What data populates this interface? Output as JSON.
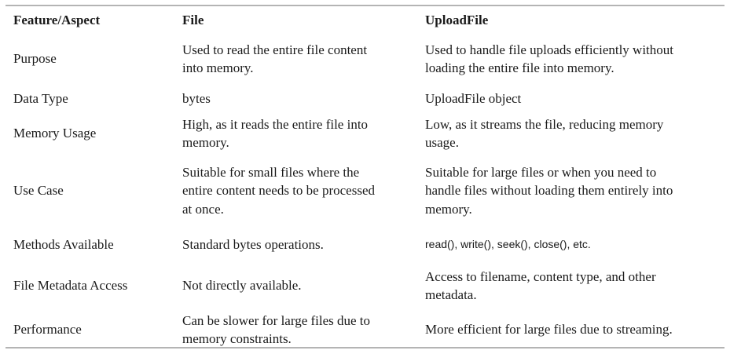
{
  "table": {
    "headers": [
      "Feature/Aspect",
      "File",
      "UploadFile"
    ],
    "rows": [
      {
        "feature": "Purpose",
        "file": "Used to read the entire file content\ninto memory.",
        "uploadfile": "Used to handle file uploads efficiently without\nloading the entire file into memory."
      },
      {
        "feature": "Data Type",
        "file": "bytes",
        "uploadfile": "UploadFile object"
      },
      {
        "feature": "Memory Usage",
        "file": "High, as it reads the entire file into\nmemory.",
        "uploadfile": "Low, as it streams the file, reducing memory\nusage."
      },
      {
        "feature": "Use Case",
        "file": "Suitable for small files where the\nentire content needs to be processed\nat once.",
        "uploadfile": "Suitable for large files or when you need to\nhandle files without loading them entirely into\nmemory."
      },
      {
        "feature": "Methods Available",
        "file": "Standard bytes operations.",
        "uploadfile": "read(), write(), seek(), close(), etc."
      },
      {
        "feature": "File Metadata Access",
        "file": "Not directly available.",
        "uploadfile": "Access to filename, content type, and other\nmetadata."
      },
      {
        "feature": "Performance",
        "file": "Can be slower for large files due to\nmemory constraints.",
        "uploadfile": "More efficient for large files due to streaming."
      }
    ]
  }
}
